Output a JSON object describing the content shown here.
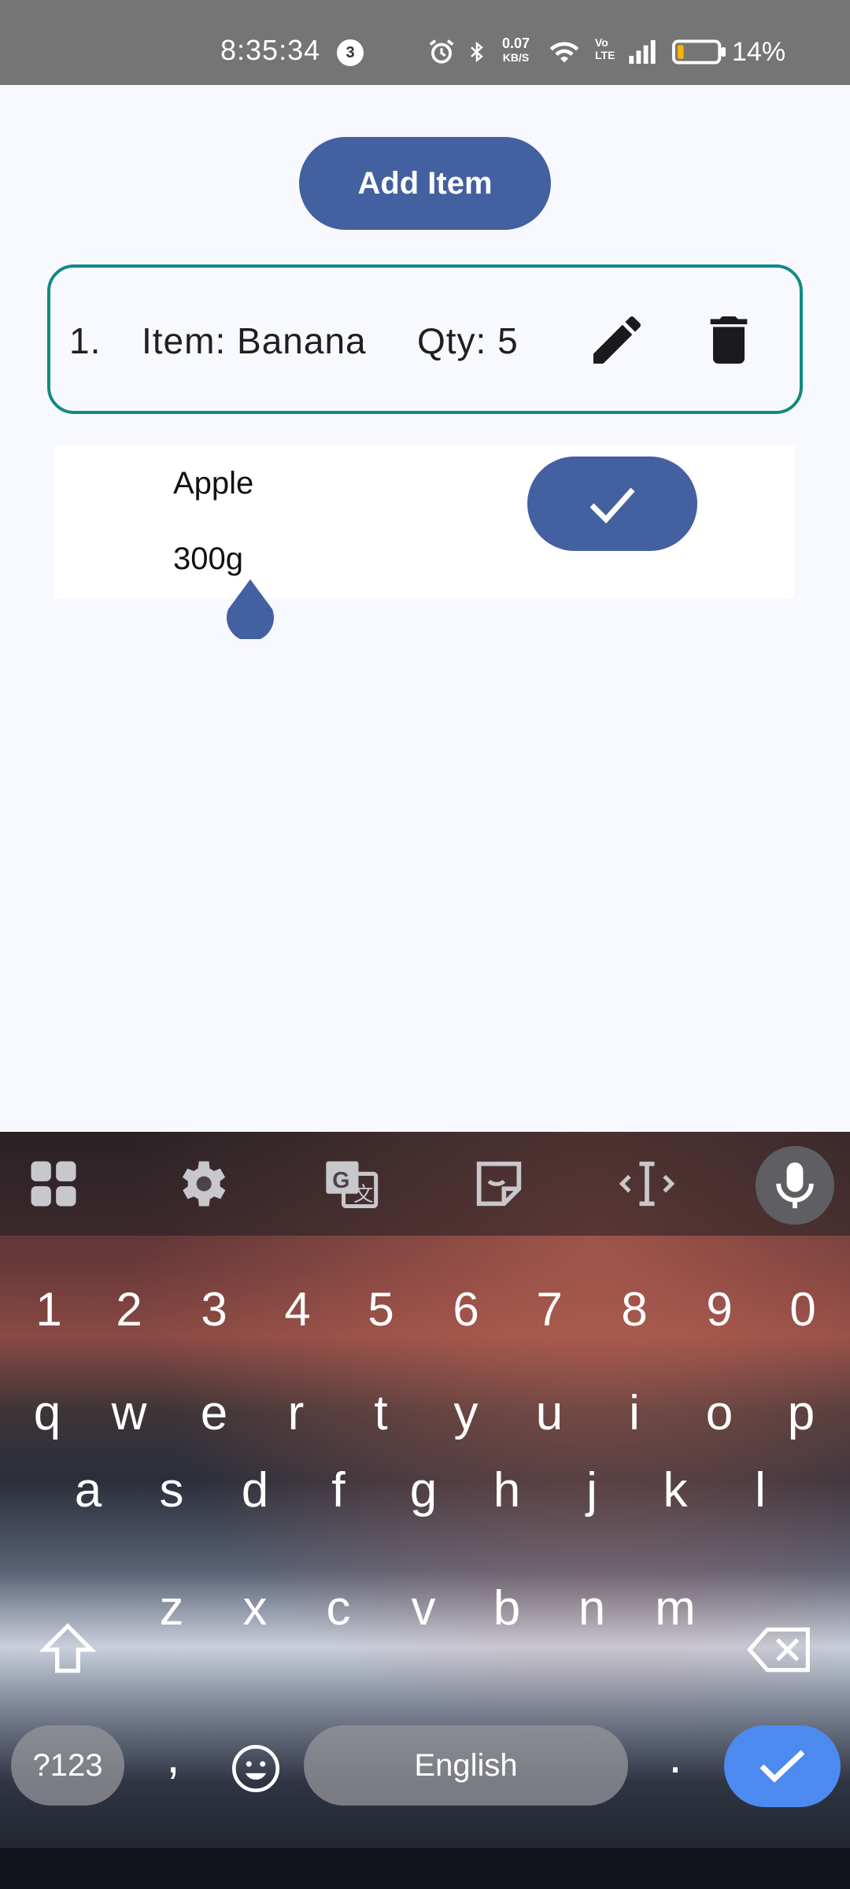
{
  "status_bar": {
    "time": "8:35:34",
    "notification_count": "3",
    "net_speed_value": "0.07",
    "net_speed_unit": "KB/S",
    "volte": "Vo LTE",
    "battery_percent": "14%",
    "icons": [
      "alarm-icon",
      "bluetooth-icon",
      "wifi-icon",
      "signal-icon",
      "battery-icon"
    ]
  },
  "add_button": {
    "label": "Add Item"
  },
  "items": [
    {
      "index": "1.",
      "name_text": "Item: Banana",
      "qty_text": "Qty: 5"
    }
  ],
  "edit_form": {
    "name_value": "Apple",
    "qty_value": "300g"
  },
  "keyboard": {
    "toolbar_icons": [
      "apps-grid-icon",
      "settings-gear-icon",
      "translate-icon",
      "sticker-icon",
      "text-cursor-icon",
      "microphone-icon"
    ],
    "number_row": [
      "1",
      "2",
      "3",
      "4",
      "5",
      "6",
      "7",
      "8",
      "9",
      "0"
    ],
    "row1": [
      "q",
      "w",
      "e",
      "r",
      "t",
      "y",
      "u",
      "i",
      "o",
      "p"
    ],
    "row2": [
      "a",
      "s",
      "d",
      "f",
      "g",
      "h",
      "j",
      "k",
      "l"
    ],
    "row3": [
      "z",
      "x",
      "c",
      "v",
      "b",
      "n",
      "m"
    ],
    "symbols_label": "?123",
    "comma": ",",
    "space_label": "English",
    "period": "."
  },
  "colors": {
    "primary_button": "#4360a0",
    "card_border": "#138a80",
    "enter_key": "#4d8af0",
    "background": "#f8f9ff"
  }
}
